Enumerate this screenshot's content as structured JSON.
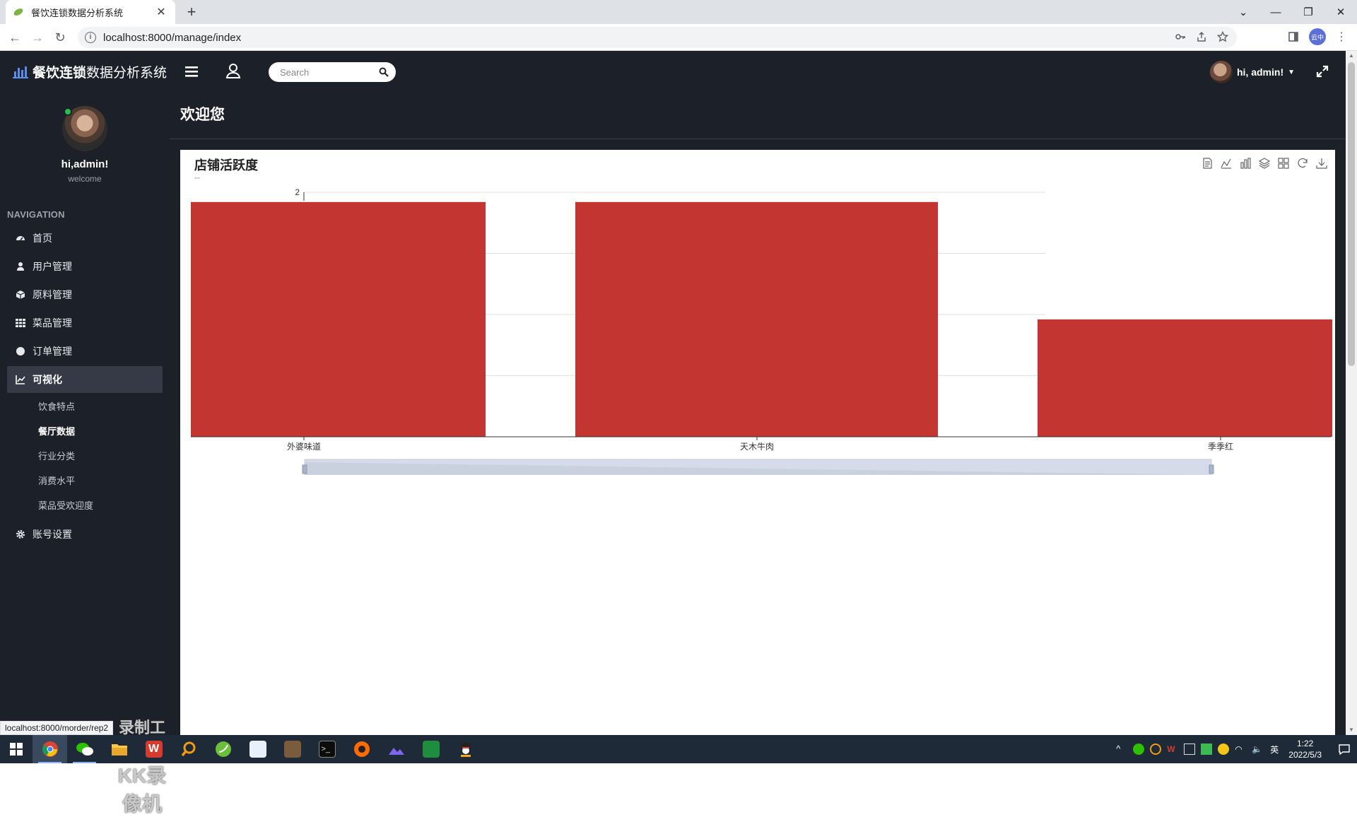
{
  "browser": {
    "tab_title": "餐饮连锁数据分析系统",
    "url": "localhost:8000/manage/index",
    "profile_label": "云中",
    "status_url": "localhost:8000/morder/rep2"
  },
  "header": {
    "brand_bold": "餐饮连锁",
    "brand_rest": "数据分析系统",
    "search_placeholder": "Search",
    "user_greeting": "hi,  admin!"
  },
  "sidebar": {
    "user_name": "hi,admin!",
    "user_sub": "welcome",
    "nav_heading": "NAVIGATION",
    "items": [
      {
        "label": "首页",
        "icon": "dashboard-icon"
      },
      {
        "label": "用户管理",
        "icon": "user-icon"
      },
      {
        "label": "原料管理",
        "icon": "cube-icon"
      },
      {
        "label": "菜品管理",
        "icon": "grid-icon"
      },
      {
        "label": "订单管理",
        "icon": "circle-icon"
      },
      {
        "label": "可视化",
        "icon": "chart-line-icon"
      }
    ],
    "sub_items": [
      {
        "label": "饮食特点"
      },
      {
        "label": "餐厅数据"
      },
      {
        "label": "行业分类"
      },
      {
        "label": "消费水平"
      },
      {
        "label": "菜品受欢迎度"
      }
    ],
    "settings_label": "账号设置",
    "watermark_line1": "录制工具",
    "watermark_line2": "KK录像机"
  },
  "main": {
    "page_title": "欢迎您",
    "chart_title": "店铺活跃度",
    "chart_subtitle": "--"
  },
  "chart_data": {
    "type": "bar",
    "title": "店铺活跃度",
    "subtitle": "--",
    "categories": [
      "外婆味道",
      "天木牛肉",
      "季季红"
    ],
    "values": [
      1.92,
      1.92,
      0.96
    ],
    "ylim": [
      0,
      2
    ],
    "ytick_labels": [
      "2"
    ],
    "grid": true,
    "color": "#c23531",
    "datazoom": true
  },
  "taskbar": {
    "time": "1:22",
    "date": "2022/5/3",
    "ime": "英"
  }
}
